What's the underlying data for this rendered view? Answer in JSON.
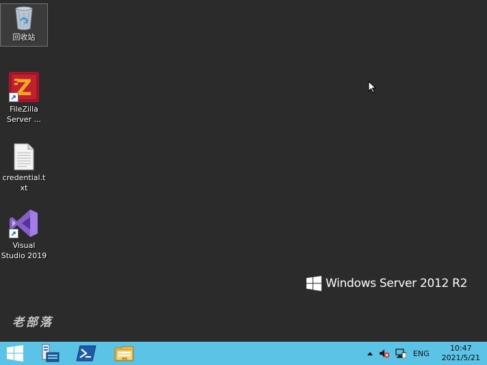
{
  "desktop": {
    "icons": [
      {
        "label": "回收站",
        "icon": "recycle-bin-icon"
      },
      {
        "label": "FileZilla Server ...",
        "icon": "filezilla-icon"
      },
      {
        "label": "credential.txt",
        "icon": "text-file-icon"
      },
      {
        "label": "Visual Studio 2019",
        "icon": "visual-studio-icon"
      }
    ],
    "brand_text": "Windows Server 2012 R2",
    "site_mark": "老部落"
  },
  "taskbar": {
    "buttons": [
      {
        "icon": "windows-start-icon"
      },
      {
        "icon": "server-manager-icon"
      },
      {
        "icon": "powershell-icon"
      },
      {
        "icon": "file-explorer-icon"
      }
    ],
    "tray": {
      "language": "ENG",
      "time": "10:47",
      "date": "2021/5/21"
    }
  },
  "colors": {
    "desktop": "#2b2b2b",
    "taskbar": "#5bc3e6"
  }
}
